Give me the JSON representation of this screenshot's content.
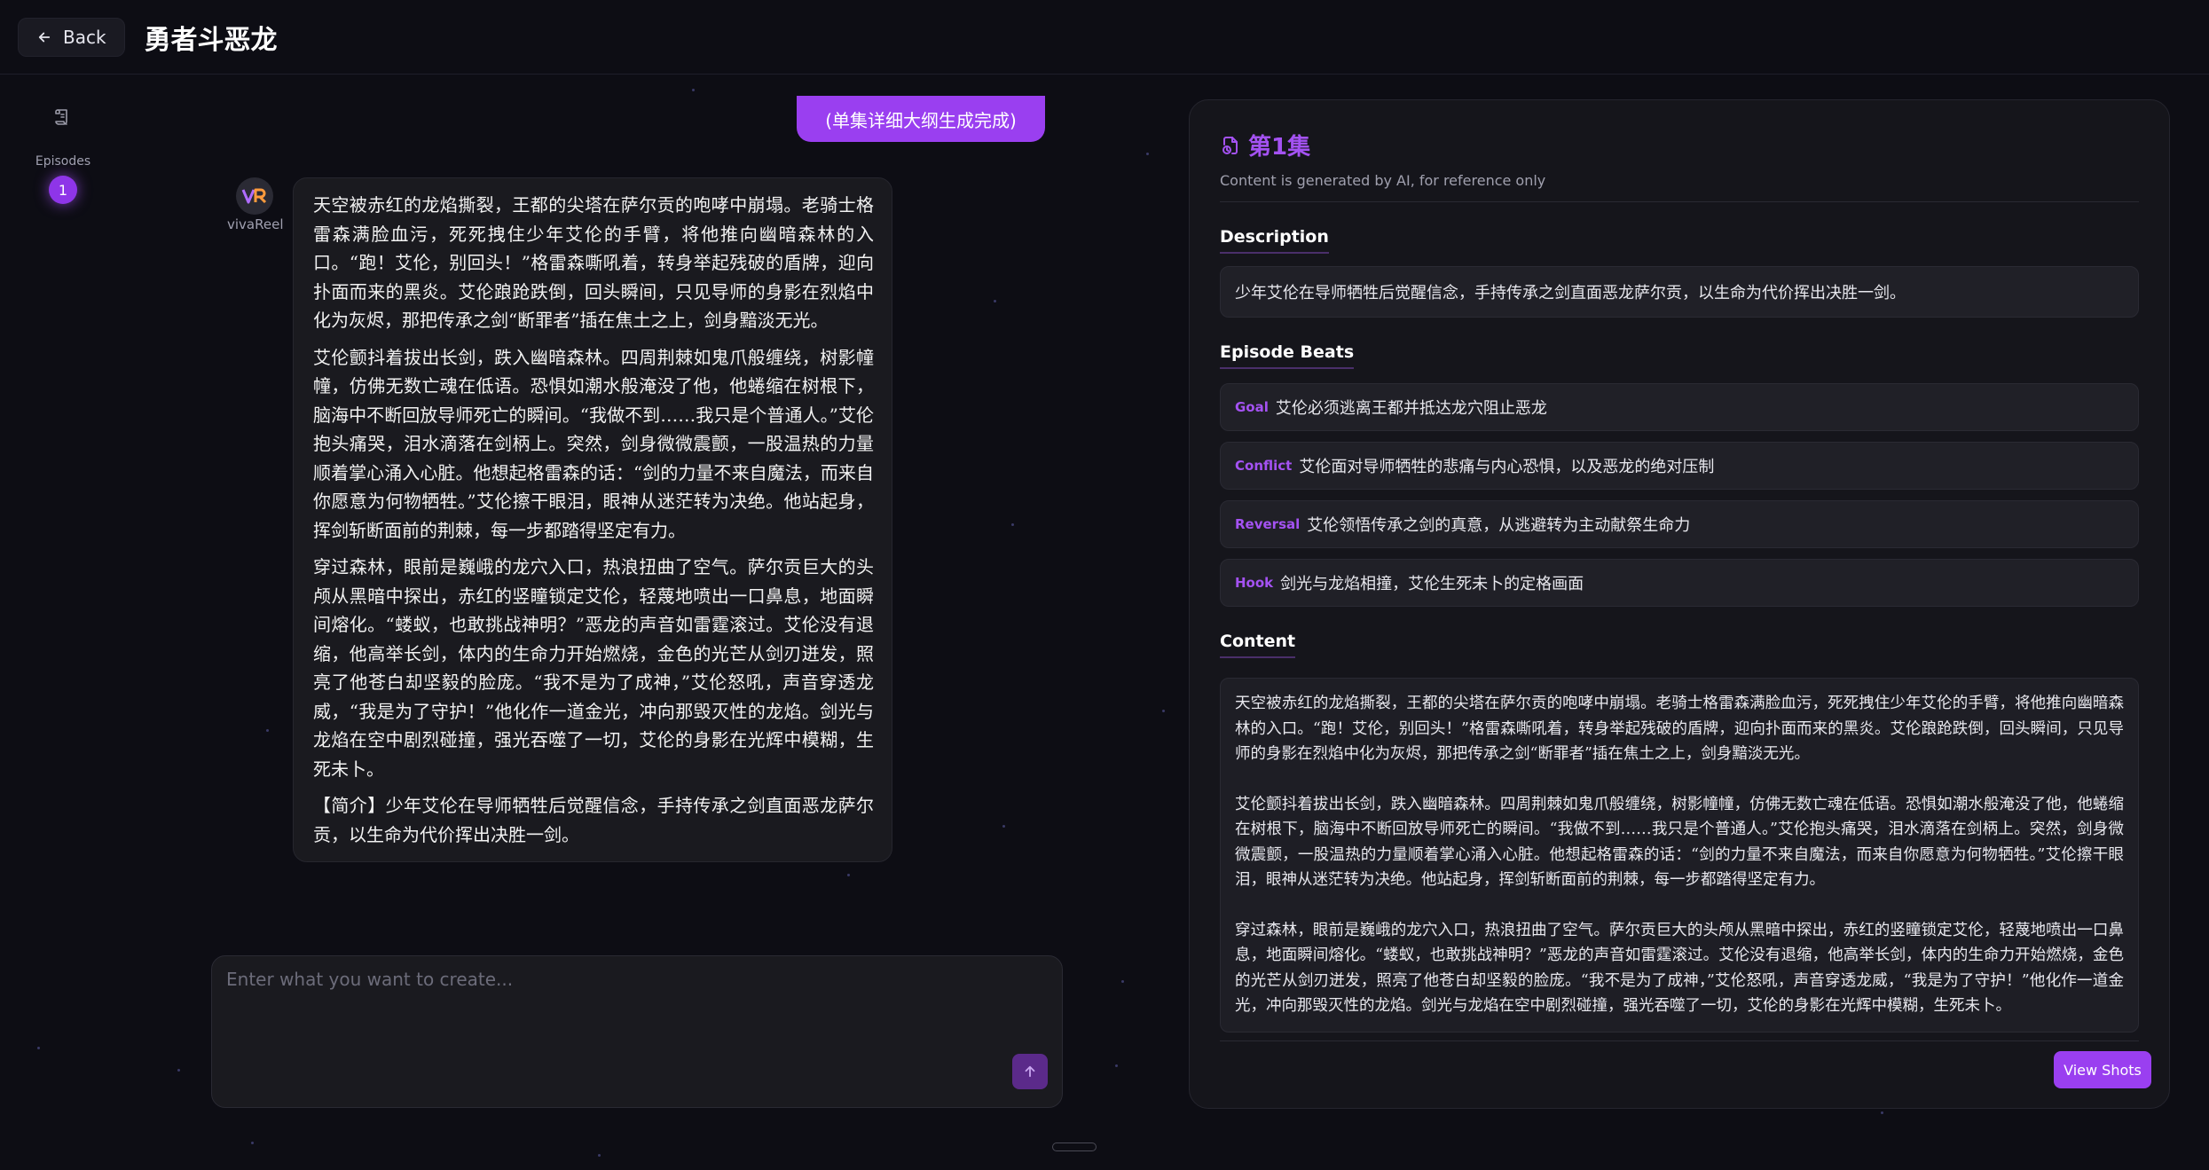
{
  "header": {
    "back_label": "Back",
    "title": "勇者斗恶龙"
  },
  "rail": {
    "episodes_label": "Episodes",
    "active_episode": "1"
  },
  "chat": {
    "status_message": "(单集详细大纲生成完成)",
    "bot_name": "vivaReel",
    "paragraphs": [
      "天空被赤红的龙焰撕裂，王都的尖塔在萨尔贡的咆哮中崩塌。老骑士格雷森满脸血污，死死拽住少年艾伦的手臂，将他推向幽暗森林的入口。“跑！艾伦，别回头！”格雷森嘶吼着，转身举起残破的盾牌，迎向扑面而来的黑炎。艾伦踉跄跌倒，回头瞬间，只见导师的身影在烈焰中化为灰烬，那把传承之剑“断罪者”插在焦土之上，剑身黯淡无光。",
      "艾伦颤抖着拔出长剑，跌入幽暗森林。四周荆棘如鬼爪般缠绕，树影幢幢，仿佛无数亡魂在低语。恐惧如潮水般淹没了他，他蜷缩在树根下，脑海中不断回放导师死亡的瞬间。“我做不到……我只是个普通人。”艾伦抱头痛哭，泪水滴落在剑柄上。突然，剑身微微震颤，一股温热的力量顺着掌心涌入心脏。他想起格雷森的话：“剑的力量不来自魔法，而来自你愿意为何物牺牲。”艾伦擦干眼泪，眼神从迷茫转为决绝。他站起身，挥剑斩断面前的荆棘，每一步都踏得坚定有力。",
      "穿过森林，眼前是巍峨的龙穴入口，热浪扭曲了空气。萨尔贡巨大的头颅从黑暗中探出，赤红的竖瞳锁定艾伦，轻蔑地喷出一口鼻息，地面瞬间熔化。“蝼蚁，也敢挑战神明？”恶龙的声音如雷霆滚过。艾伦没有退缩，他高举长剑，体内的生命力开始燃烧，金色的光芒从剑刃迸发，照亮了他苍白却坚毅的脸庞。“我不是为了成神，”艾伦怒吼，声音穿透龙威，“我是为了守护！”他化作一道金光，冲向那毁灭性的龙焰。剑光与龙焰在空中剧烈碰撞，强光吞噬了一切，艾伦的身影在光辉中模糊，生死未卜。",
      "【简介】少年艾伦在导师牺牲后觉醒信念，手持传承之剑直面恶龙萨尔贡，以生命为代价挥出决胜一剑。"
    ]
  },
  "composer": {
    "placeholder": "Enter what you want to create..."
  },
  "panel": {
    "episode_title": "第1集",
    "subtitle": "Content is generated by AI, for reference only",
    "description_heading": "Description",
    "description": "少年艾伦在导师牺牲后觉醒信念，手持传承之剑直面恶龙萨尔贡，以生命为代价挥出决胜一剑。",
    "beats_heading": "Episode Beats",
    "beats": [
      {
        "tag": "Goal",
        "text": "艾伦必须逃离王都并抵达龙穴阻止恶龙"
      },
      {
        "tag": "Conflict",
        "text": "艾伦面对导师牺牲的悲痛与内心恐惧，以及恶龙的绝对压制"
      },
      {
        "tag": "Reversal",
        "text": "艾伦领悟传承之剑的真意，从逃避转为主动献祭生命力"
      },
      {
        "tag": "Hook",
        "text": "剑光与龙焰相撞，艾伦生死未卜的定格画面"
      }
    ],
    "content_heading": "Content",
    "content_paragraphs": [
      "天空被赤红的龙焰撕裂，王都的尖塔在萨尔贡的咆哮中崩塌。老骑士格雷森满脸血污，死死拽住少年艾伦的手臂，将他推向幽暗森林的入口。“跑！艾伦，别回头！”格雷森嘶吼着，转身举起残破的盾牌，迎向扑面而来的黑炎。艾伦踉跄跌倒，回头瞬间，只见导师的身影在烈焰中化为灰烬，那把传承之剑“断罪者”插在焦土之上，剑身黯淡无光。",
      "艾伦颤抖着拔出长剑，跌入幽暗森林。四周荆棘如鬼爪般缠绕，树影幢幢，仿佛无数亡魂在低语。恐惧如潮水般淹没了他，他蜷缩在树根下，脑海中不断回放导师死亡的瞬间。“我做不到……我只是个普通人。”艾伦抱头痛哭，泪水滴落在剑柄上。突然，剑身微微震颤，一股温热的力量顺着掌心涌入心脏。他想起格雷森的话：“剑的力量不来自魔法，而来自你愿意为何物牺牲。”艾伦擦干眼泪，眼神从迷茫转为决绝。他站起身，挥剑斩断面前的荆棘，每一步都踏得坚定有力。",
      "穿过森林，眼前是巍峨的龙穴入口，热浪扭曲了空气。萨尔贡巨大的头颅从黑暗中探出，赤红的竖瞳锁定艾伦，轻蔑地喷出一口鼻息，地面瞬间熔化。“蝼蚁，也敢挑战神明？”恶龙的声音如雷霆滚过。艾伦没有退缩，他高举长剑，体内的生命力开始燃烧，金色的光芒从剑刃迸发，照亮了他苍白却坚毅的脸庞。“我不是为了成神，”艾伦怒吼，声音穿透龙威，“我是为了守护！”他化作一道金光，冲向那毁灭性的龙焰。剑光与龙焰在空中剧烈碰撞，强光吞噬了一切，艾伦的身影在光辉中模糊，生死未卜。"
    ],
    "view_shots_label": "View Shots"
  },
  "theme": {
    "accent": "#9a3ff0",
    "background": "#0d0d14",
    "card": "#1a1a1f"
  }
}
